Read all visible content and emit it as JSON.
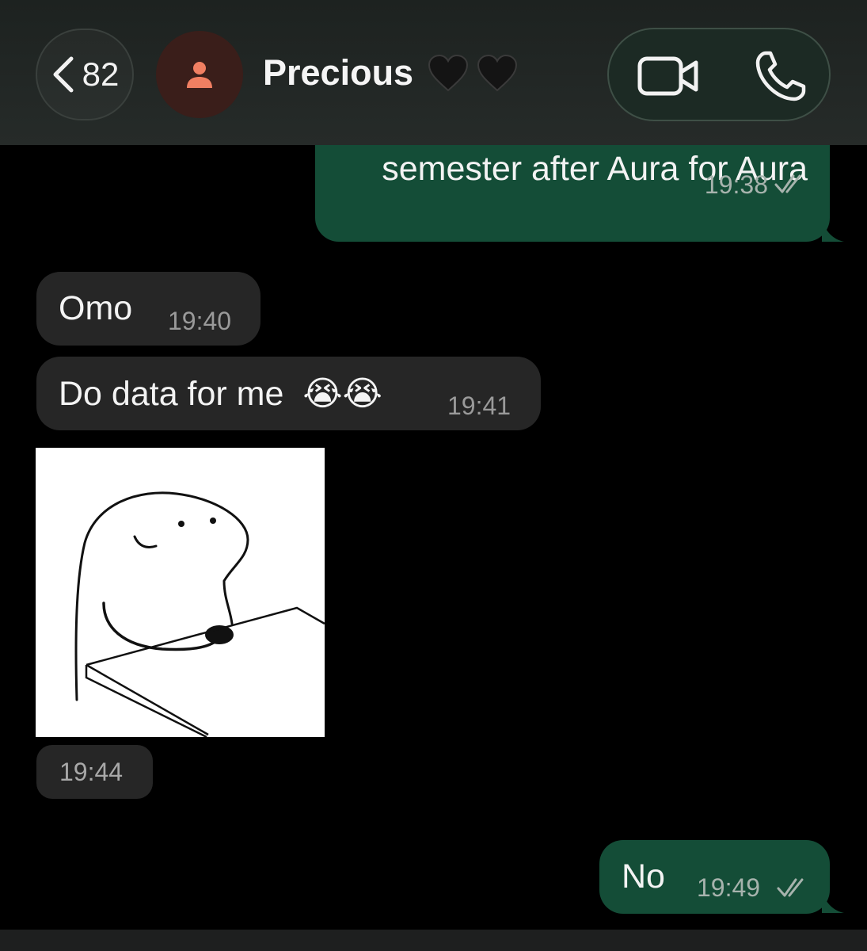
{
  "header": {
    "back_count": "82",
    "contact_name": "Precious",
    "status_icon_colors": {
      "avatar_bg": "#3a1e1a",
      "avatar_fg": "#f07f62",
      "accent": "#144d37"
    }
  },
  "messages": [
    {
      "direction": "outgoing",
      "text": "semester after Aura for Aura",
      "time": "19:38",
      "status": "read"
    },
    {
      "direction": "incoming",
      "text": "Omo",
      "time": "19:40"
    },
    {
      "direction": "incoming",
      "text": "Do data for me",
      "emoji": "😭😭",
      "time": "19:41"
    },
    {
      "direction": "incoming",
      "type": "sticker",
      "time": "19:44"
    },
    {
      "direction": "outgoing",
      "text": "No",
      "time": "19:49",
      "status": "read"
    }
  ]
}
